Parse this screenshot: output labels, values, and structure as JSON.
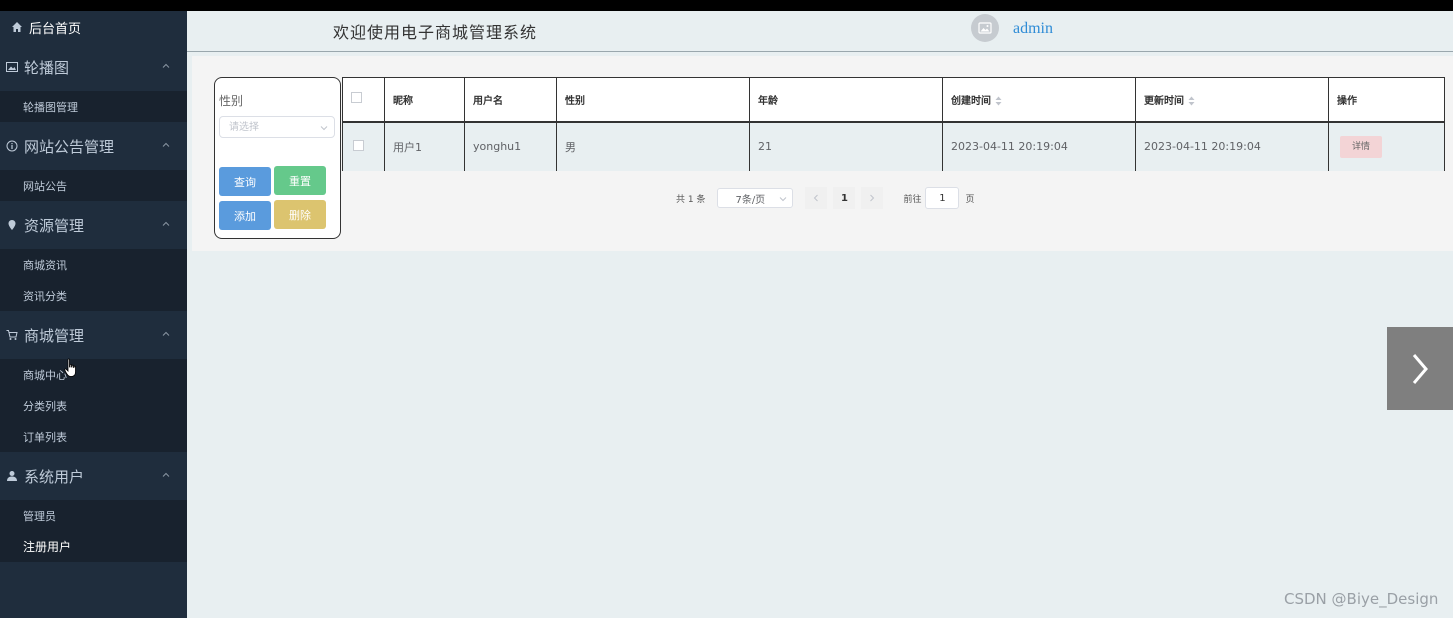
{
  "sidebar": {
    "home": "后台首页",
    "groups": [
      {
        "label": "轮播图",
        "icon": "picture-icon",
        "items": [
          "轮播图管理"
        ]
      },
      {
        "label": "网站公告管理",
        "icon": "info-circle-icon",
        "items": [
          "网站公告"
        ]
      },
      {
        "label": "资源管理",
        "icon": "location-pin-icon",
        "items": [
          "商城资讯",
          "资讯分类"
        ]
      },
      {
        "label": "商城管理",
        "icon": "cart-icon",
        "items": [
          "商城中心",
          "分类列表",
          "订单列表"
        ]
      },
      {
        "label": "系统用户",
        "icon": "user-icon",
        "items": [
          "管理员",
          "注册用户"
        ]
      }
    ]
  },
  "header": {
    "welcome": "欢迎使用电子商城管理系统",
    "username": "admin"
  },
  "search": {
    "label": "性别",
    "placeholder": "请选择",
    "btn_query": "查询",
    "btn_reset": "重置",
    "btn_add": "添加",
    "btn_delete": "删除"
  },
  "table": {
    "headers": [
      "昵称",
      "用户名",
      "性别",
      "年龄",
      "创建时间",
      "更新时间",
      "操作"
    ],
    "rows": [
      {
        "nickname": "用户1",
        "username": "yonghu1",
        "gender": "男",
        "age": "21",
        "created": "2023-04-11 20:19:04",
        "updated": "2023-04-11 20:19:04",
        "action": "详情"
      }
    ]
  },
  "pager": {
    "total": "共 1 条",
    "size": "7条/页",
    "current": "1",
    "goto_prefix": "前往",
    "goto_value": "1",
    "goto_suffix": "页"
  },
  "watermark": "CSDN @Biye_Design"
}
